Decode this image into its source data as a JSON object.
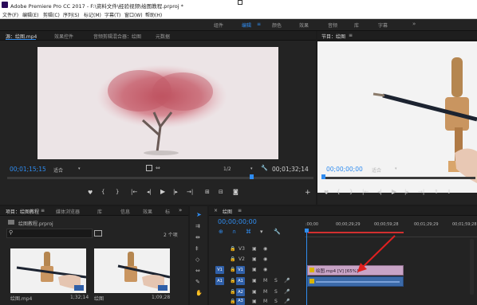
{
  "app": {
    "title": "Adobe Premiere Pro CC 2017 - F:\\资料文件\\经验视频\\绘图教程.prproj *"
  },
  "menu": [
    "文件(F)",
    "编辑(E)",
    "剪辑(C)",
    "序列(S)",
    "标记(M)",
    "字幕(T)",
    "窗口(W)",
    "帮助(H)"
  ],
  "workspaces": {
    "items": [
      "组件",
      "编辑",
      "颜色",
      "效果",
      "音频",
      "库",
      "字幕"
    ],
    "active": "编辑",
    "more": "»"
  },
  "source_panel": {
    "tabs": [
      "源：绘图.mp4",
      "效果控件",
      "音频剪辑混合器：绘图",
      "元数据"
    ],
    "timecode_in": "00;01;15;15",
    "fit": "适合",
    "resolution": "1/2",
    "timecode_out": "00;01;32;14"
  },
  "program_panel": {
    "tab": "节目：绘图",
    "timecode": "00;00;00;00",
    "fit": "适合"
  },
  "project_panel": {
    "tabs": [
      "项目：绘图教程",
      "媒体浏览器",
      "库",
      "信息",
      "效果",
      "标"
    ],
    "file": "绘图教程.prproj",
    "item_count": "2 个项",
    "items": [
      {
        "name": "绘图.mp4",
        "duration": "1;32;14"
      },
      {
        "name": "绘图",
        "duration": "1;09;28"
      }
    ]
  },
  "timeline": {
    "tab": "绘图",
    "timecode": "00;00;00;00",
    "ruler": [
      ":00;00",
      "00;00;29;29",
      "00;00;59;28",
      "00;01;29;29",
      "00;01;59;28"
    ],
    "video_tracks": [
      "V3",
      "V2",
      "V1"
    ],
    "audio_tracks": [
      "A1",
      "A2",
      "A3"
    ],
    "src_video": "V1",
    "src_audio": "A1",
    "clip_label": "绘图.mp4 [V] [65%]",
    "audio_buttons": [
      "M",
      "S"
    ]
  },
  "colors": {
    "accent": "#2f8cf0",
    "video_clip": "#c8a4c6",
    "audio_clip": "#3c6aa8",
    "in_out_bar": "#d23030"
  }
}
